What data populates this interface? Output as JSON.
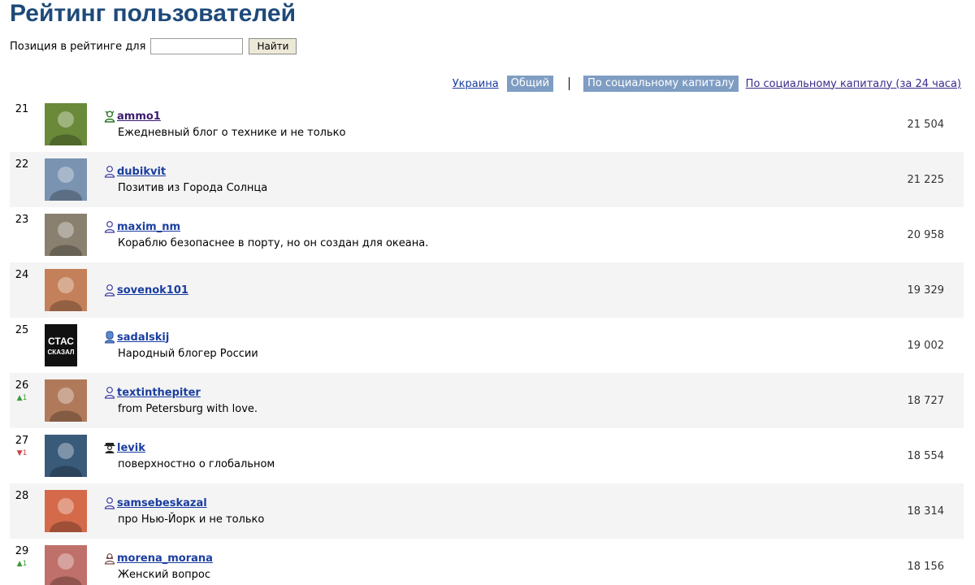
{
  "page": {
    "title": "Рейтинг пользователей"
  },
  "search": {
    "label": "Позиция в рейтинге для",
    "value": "",
    "placeholder": "",
    "button_label": "Найти"
  },
  "filters": {
    "region_link": "Украина",
    "region_active": "Общий",
    "sort_active": "По социальному капиталу",
    "sort_link": "По социальному капиталу (за 24 часа)"
  },
  "users": [
    {
      "rank": "21",
      "change": "",
      "change_dir": "",
      "name": "ammo1",
      "icon": "crown-user-icon",
      "desc": "Ежедневный блог о технике и не только",
      "score": "21 504",
      "avatar_color": "#6a8a3a"
    },
    {
      "rank": "22",
      "change": "",
      "change_dir": "",
      "name": "dubikvit",
      "icon": "user-icon",
      "desc": "Позитив из Города Солнца",
      "score": "21 225",
      "avatar_color": "#7a93b0"
    },
    {
      "rank": "23",
      "change": "",
      "change_dir": "",
      "name": "maxim_nm",
      "icon": "user-icon",
      "desc": "Кораблю безопаснее в порту, но он создан для океана.",
      "score": "20 958",
      "avatar_color": "#8a8070"
    },
    {
      "rank": "24",
      "change": "",
      "change_dir": "",
      "name": "sovenok101",
      "icon": "user-icon",
      "desc": "",
      "score": "19 329",
      "avatar_color": "#c4805a"
    },
    {
      "rank": "25",
      "change": "",
      "change_dir": "",
      "name": "sadalskij",
      "icon": "blue-user-icon",
      "desc": "Народный блогер России",
      "score": "19 002",
      "avatar_color": "#111111",
      "avatar_text": "СТАС",
      "avatar_subtext": "СКАЗАЛ"
    },
    {
      "rank": "26",
      "change": "▲1",
      "change_dir": "up",
      "name": "textinthepiter",
      "icon": "user-icon",
      "desc": "from Petersburg with love.",
      "score": "18 727",
      "avatar_color": "#b07a5a"
    },
    {
      "rank": "27",
      "change": "▼1",
      "change_dir": "down",
      "name": "levik",
      "icon": "hat-user-icon",
      "desc": "поверхностно о глобальном",
      "score": "18 554",
      "avatar_color": "#3a5a7a"
    },
    {
      "rank": "28",
      "change": "",
      "change_dir": "",
      "name": "samsebeskazal",
      "icon": "user-icon",
      "desc": "про Нью-Йорк и не только",
      "score": "18 314",
      "avatar_color": "#d46a4a"
    },
    {
      "rank": "29",
      "change": "▲1",
      "change_dir": "up",
      "name": "morena_morana",
      "icon": "female-user-icon",
      "desc": "Женский вопрос",
      "score": "18 156",
      "avatar_color": "#c0706a"
    }
  ]
}
